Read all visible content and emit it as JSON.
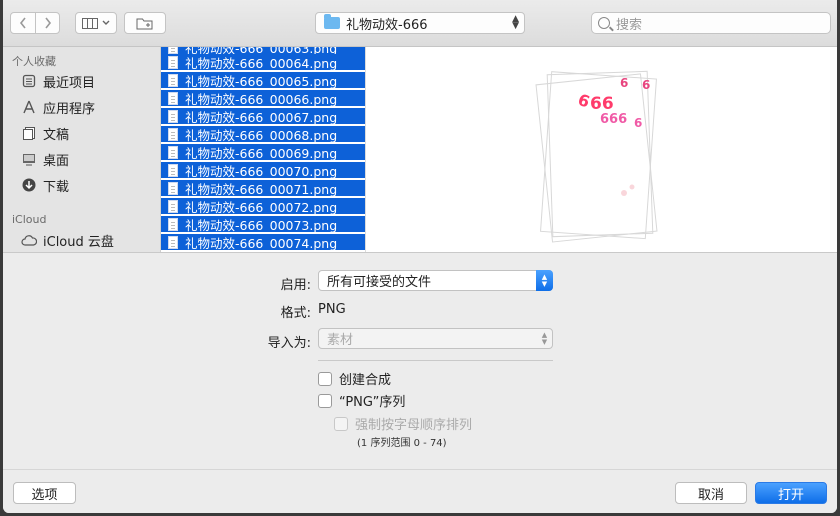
{
  "toolbar": {
    "back_icon": "chevron-left-icon",
    "forward_icon": "chevron-right-icon",
    "view_icon": "column-view-icon",
    "new_folder_icon": "new-folder-icon",
    "path": "礼物动效-666",
    "search_placeholder": "搜索"
  },
  "sidebar": {
    "favorites_header": "个人收藏",
    "favorites": [
      {
        "label": "最近项目",
        "icon": "recents-icon"
      },
      {
        "label": "应用程序",
        "icon": "applications-icon"
      },
      {
        "label": "文稿",
        "icon": "documents-icon"
      },
      {
        "label": "桌面",
        "icon": "desktop-icon"
      },
      {
        "label": "下载",
        "icon": "downloads-icon"
      }
    ],
    "icloud_header": "iCloud",
    "icloud": [
      {
        "label": "iCloud 云盘",
        "icon": "cloud-icon"
      }
    ]
  },
  "files": [
    "礼物动效-666_00063.png",
    "礼物动效-666_00064.png",
    "礼物动效-666_00065.png",
    "礼物动效-666_00066.png",
    "礼物动效-666_00067.png",
    "礼物动效-666_00068.png",
    "礼物动效-666_00069.png",
    "礼物动效-666_00070.png",
    "礼物动效-666_00071.png",
    "礼物动效-666_00072.png",
    "礼物动效-666_00073.png",
    "礼物动效-666_00074.png"
  ],
  "options": {
    "enable_label": "启用:",
    "enable_value": "所有可接受的文件",
    "format_label": "格式:",
    "format_value": "PNG",
    "import_label": "导入为:",
    "import_value": "素材",
    "create_comp_label": "创建合成",
    "png_sequence_label": "“PNG”序列",
    "force_alpha_label": "强制按字母顺序排列",
    "sequence_note": "(1 序列范围 0 - 74)"
  },
  "buttons": {
    "options": "选项",
    "cancel": "取消",
    "open": "打开"
  },
  "colors": {
    "selection": "#0d61d8",
    "accent": "#0e6ee8",
    "preview_pink": "#ff3b6b"
  }
}
